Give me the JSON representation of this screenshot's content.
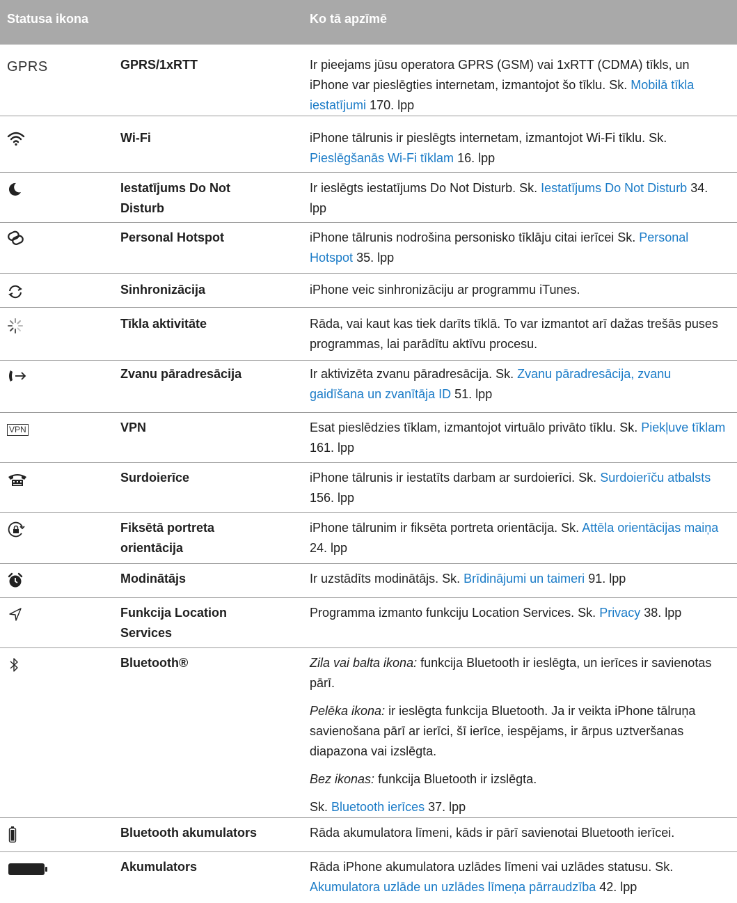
{
  "header": {
    "col1": "Statusa ikona",
    "col2": "Ko tā apzīmē"
  },
  "rows": [
    {
      "icon_name": "gprs-icon",
      "icon_text": "GPRS",
      "name": "GPRS/1xRTT",
      "d1": "Ir pieejams jūsu operatora GPRS (GSM) vai 1xRTT (CDMA) tīkls, un iPhone var pieslēgties internetam, izmantojot šo tīklu. Sk.",
      "link": "Mobilā tīkla iestatījumi",
      "d2": "170. lpp"
    },
    {
      "icon_name": "wifi-icon",
      "name": "Wi-Fi",
      "d1": "iPhone tālrunis ir pieslēgts internetam, izmantojot Wi-Fi tīklu. Sk.",
      "link": "Pieslēgšanās Wi-Fi tīklam",
      "d2": "16. lpp"
    },
    {
      "icon_name": "moon-icon",
      "name": "Iestatījums Do Not Disturb",
      "d1": "Ir ieslēgts iestatījums Do Not Disturb. Sk.",
      "link": "Iestatījums Do Not Disturb",
      "d2": "34. lpp"
    },
    {
      "icon_name": "personal-hotspot-icon",
      "name": "Personal Hotspot",
      "d1": "iPhone tālrunis nodrošina personisko tīklāju citai ierīcei Sk.",
      "link": "Personal Hotspot",
      "d2": "35. lpp"
    },
    {
      "icon_name": "sync-icon",
      "name": "Sinhronizācija",
      "d1": "iPhone veic sinhronizāciju ar programmu iTunes."
    },
    {
      "icon_name": "network-activity-icon",
      "name": "Tīkla aktivitāte",
      "d1": "Rāda, vai kaut kas tiek darīts tīklā. To var izmantot arī dažas trešās puses programmas, lai parādītu aktīvu procesu."
    },
    {
      "icon_name": "call-forwarding-icon",
      "name": "Zvanu pāradresācija",
      "d1": "Ir aktivizēta zvanu pāradresācija. Sk.",
      "link": "Zvanu pāradresācija, zvanu gaidīšana un zvanītāja ID",
      "d2": "51. lpp"
    },
    {
      "icon_name": "vpn-icon",
      "icon_text": "VPN",
      "name": "VPN",
      "d1": "Esat pieslēdzies tīklam, izmantojot virtuālo privāto tīklu. Sk.",
      "link": "Piekļuve tīklam",
      "d2": "161. lpp"
    },
    {
      "icon_name": "tty-icon",
      "name": "Surdoierīce",
      "d1": "iPhone tālrunis ir iestatīts darbam ar surdoierīci. Sk.",
      "link": "Surdoierīču atbalsts",
      "d2": "156. lpp"
    },
    {
      "icon_name": "orientation-lock-icon",
      "name": "Fiksētā portreta orientācija",
      "d1": "iPhone tālrunim ir fiksēta portreta orientācija. Sk.",
      "link": "Attēla orientācijas maiņa",
      "d2": "24. lpp"
    },
    {
      "icon_name": "alarm-icon",
      "name": "Modinātājs",
      "d1": "Ir uzstādīts modinātājs. Sk.",
      "link": "Brīdinājumi un taimeri",
      "d2": "91. lpp"
    },
    {
      "icon_name": "location-icon",
      "name": "Funkcija Location Services",
      "d1": "Programma izmanto funkciju Location Services. Sk.",
      "link": "Privacy",
      "d2": "38. lpp"
    },
    {
      "icon_name": "bluetooth-icon",
      "name": "Bluetooth®",
      "p1_i": "Zila vai balta ikona:",
      "p1": "funkcija Bluetooth ir ieslēgta, un ierīces ir savienotas pārī.",
      "p2_i": "Pelēka ikona:",
      "p2": "ir ieslēgta funkcija Bluetooth. Ja ir veikta iPhone tālruņa savienošana pārī ar ierīci, šī ierīce, iespējams, ir ārpus uztveršanas diapazona vai izslēgta.",
      "p3_i": "Bez ikonas:",
      "p3": "funkcija Bluetooth ir izslēgta.",
      "d1": "Sk.",
      "link": "Bluetooth ierīces",
      "d2": "37. lpp"
    },
    {
      "icon_name": "bluetooth-battery-icon",
      "name": "Bluetooth akumulators",
      "d1": "Rāda akumulatora līmeni, kāds ir pārī savienotai Bluetooth ierīcei."
    },
    {
      "icon_name": "battery-icon",
      "name": "Akumulators",
      "d1": "Rāda iPhone akumulatora uzlādes līmeni vai uzlādes statusu. Sk.",
      "link": "Akumulatora uzlāde un uzlādes līmeņa pārraudzība",
      "d2": "42. lpp"
    }
  ]
}
